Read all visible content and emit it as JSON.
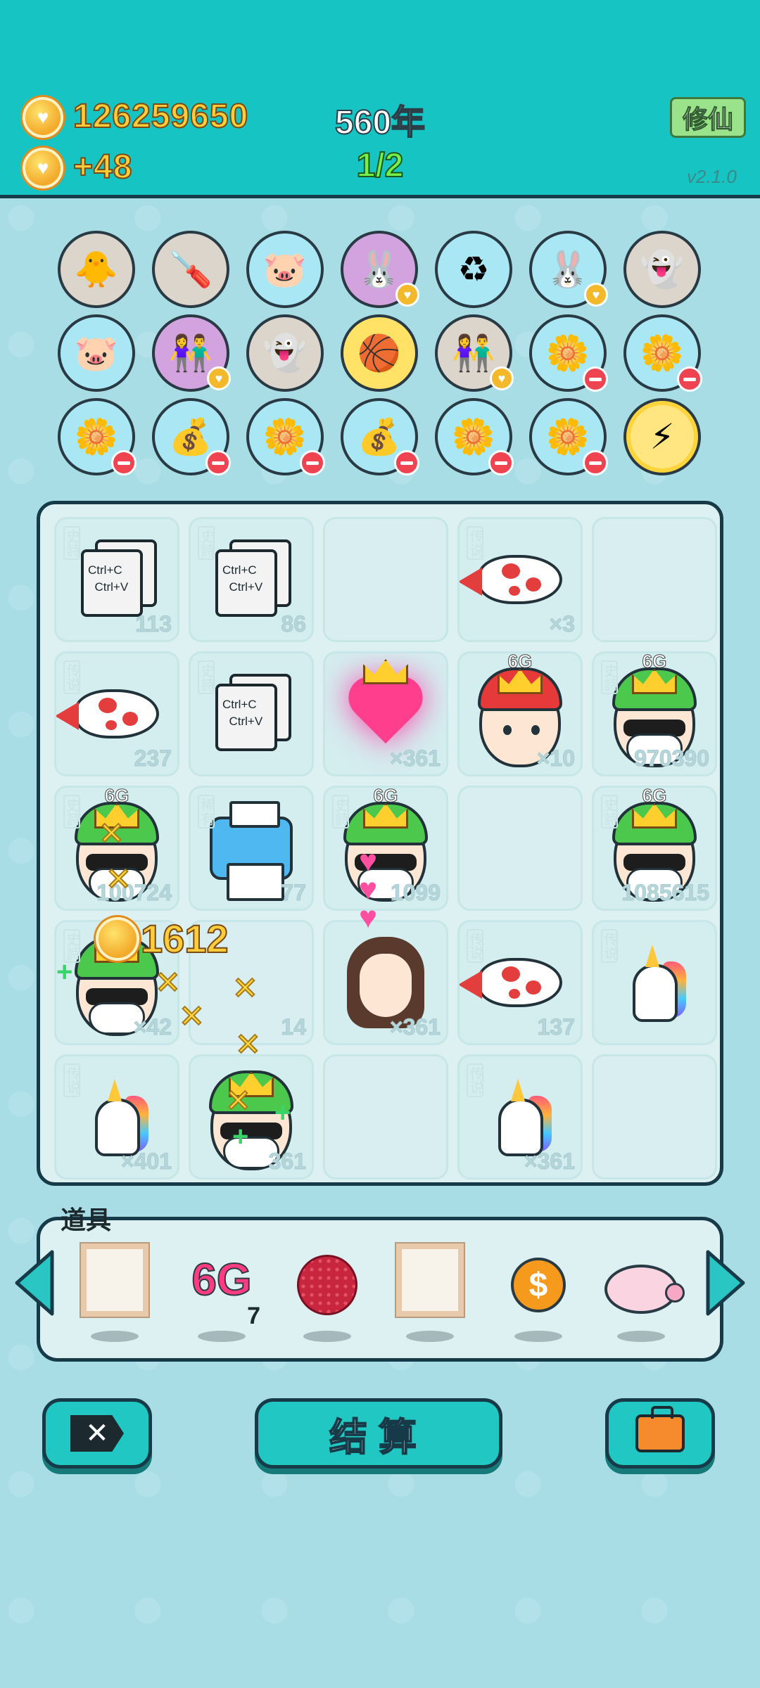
{
  "header": {
    "coins": "126259650",
    "income": "+48",
    "year": "560年",
    "progress": "1/2",
    "xiuxian_label": "修仙",
    "version": "v2.1.0"
  },
  "collection": {
    "rows": [
      [
        {
          "icon": "chick-egg-icon",
          "glyph": "🐥",
          "bg": "tan",
          "badge": ""
        },
        {
          "icon": "screwdriver-icon",
          "glyph": "🪛",
          "bg": "tan",
          "badge": ""
        },
        {
          "icon": "piggy-bank-icon",
          "glyph": "🐷",
          "bg": "blue",
          "badge": ""
        },
        {
          "icon": "rabbit-icon",
          "glyph": "🐰",
          "bg": "purple",
          "badge": "heart"
        },
        {
          "icon": "recycle-bag-icon",
          "glyph": "♻",
          "bg": "blue",
          "badge": ""
        },
        {
          "icon": "rabbit-icon",
          "glyph": "🐰",
          "bg": "blue",
          "badge": "heart"
        },
        {
          "icon": "ghost-icon",
          "glyph": "👻",
          "bg": "tan",
          "badge": ""
        }
      ],
      [
        {
          "icon": "piggy-bank-icon",
          "glyph": "🐷",
          "bg": "blue",
          "badge": ""
        },
        {
          "icon": "couple-icon",
          "glyph": "👫",
          "bg": "purple",
          "badge": "heart"
        },
        {
          "icon": "ghost-icon",
          "glyph": "👻",
          "bg": "tan",
          "badge": ""
        },
        {
          "icon": "basketballs-icon",
          "glyph": "🏀",
          "bg": "yellow",
          "badge": ""
        },
        {
          "icon": "couple-icon",
          "glyph": "👫",
          "bg": "tan",
          "badge": "heart"
        },
        {
          "icon": "flower-pot-icon",
          "glyph": "🌼",
          "bg": "blue",
          "badge": "minus"
        },
        {
          "icon": "flower-pot-icon",
          "glyph": "🌼",
          "bg": "blue",
          "badge": "minus"
        }
      ],
      [
        {
          "icon": "flower-pot-icon",
          "glyph": "🌼",
          "bg": "blue",
          "badge": "minus"
        },
        {
          "icon": "money-bag-icon",
          "glyph": "💰",
          "bg": "blue",
          "badge": "minus"
        },
        {
          "icon": "flower-pot-icon",
          "glyph": "🌼",
          "bg": "blue",
          "badge": "minus"
        },
        {
          "icon": "money-bag-icon",
          "glyph": "💰",
          "bg": "blue",
          "badge": "minus"
        },
        {
          "icon": "flower-pot-icon",
          "glyph": "🌼",
          "bg": "blue",
          "badge": "minus"
        },
        {
          "icon": "flower-pot-icon",
          "glyph": "🌼",
          "bg": "blue",
          "badge": "minus"
        },
        {
          "icon": "lightning-icon",
          "glyph": "⚡",
          "bg": "special",
          "badge": ""
        }
      ]
    ]
  },
  "board": {
    "cells": [
      {
        "type": "copy",
        "tag": "史詩",
        "count": "113",
        "copy_line1": "Ctrl+C",
        "copy_line2": "Ctrl+V"
      },
      {
        "type": "copy",
        "tag": "史詩",
        "count": "86",
        "copy_line1": "Ctrl+C",
        "copy_line2": "Ctrl+V"
      },
      {
        "type": "empty"
      },
      {
        "type": "fish",
        "tag": "传说",
        "count": "×3"
      },
      {
        "type": "empty"
      },
      {
        "type": "fish",
        "tag": "传说",
        "count": "237"
      },
      {
        "type": "copy",
        "tag": "史詩",
        "count": "",
        "copy_line1": "Ctrl+C",
        "copy_line2": "Ctrl+V"
      },
      {
        "type": "heart",
        "tag": "",
        "count": "×361"
      },
      {
        "type": "face-red",
        "tag": "",
        "count": "×10",
        "badge": "6G"
      },
      {
        "type": "face-green",
        "tag": "史詩",
        "count": "970390",
        "badge": "6G"
      },
      {
        "type": "face-green",
        "tag": "史詩",
        "count": "100724",
        "badge": "6G"
      },
      {
        "type": "printer",
        "tag": "稀有",
        "count": "77"
      },
      {
        "type": "face-green",
        "tag": "史詩",
        "count": "1099",
        "badge": "6G"
      },
      {
        "type": "empty"
      },
      {
        "type": "face-green",
        "tag": "史詩",
        "count": "1085615",
        "badge": "6G"
      },
      {
        "type": "face-green",
        "tag": "史詩",
        "count": "×42"
      },
      {
        "type": "empty",
        "count": "14"
      },
      {
        "type": "girl",
        "tag": "",
        "count": "×361"
      },
      {
        "type": "fish",
        "tag": "传说",
        "count": "137"
      },
      {
        "type": "unicorn",
        "tag": "传说",
        "count": ""
      },
      {
        "type": "unicorn",
        "tag": "传说",
        "count": "×401"
      },
      {
        "type": "face-green",
        "tag": "",
        "count": "361"
      },
      {
        "type": "empty"
      },
      {
        "type": "unicorn",
        "tag": "传说",
        "count": "×361"
      },
      {
        "type": "empty"
      }
    ],
    "fx_coin_value": "1612"
  },
  "tools": {
    "label": "道具",
    "items": [
      {
        "icon": "frame-icon",
        "kind": "frame"
      },
      {
        "icon": "6g-icon",
        "kind": "g6",
        "text": "6G",
        "count": "7"
      },
      {
        "icon": "lychee-icon",
        "kind": "lychee"
      },
      {
        "icon": "frame-icon",
        "kind": "frame"
      },
      {
        "icon": "dollar-coin-icon",
        "kind": "dollar",
        "text": "$"
      },
      {
        "icon": "piggy-bank-icon",
        "kind": "pig"
      }
    ]
  },
  "bottom": {
    "close_glyph": "✕",
    "settle_label": "结算"
  },
  "colors": {
    "header_bg": "#17c4c4",
    "body_bg": "#a8dde6",
    "button_bg": "#21c7c2",
    "outline": "#163a48",
    "coin_text": "#ffcc3a",
    "progress_text": "#76f04a"
  }
}
